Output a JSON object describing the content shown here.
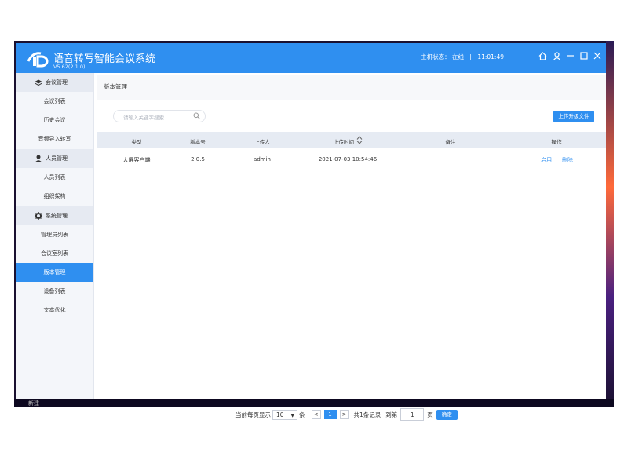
{
  "app": {
    "title": "语音转写智能会议系统",
    "version": "V5.62(2.1.0)",
    "host_label": "主机状态：",
    "host_status": "在线",
    "separator": "|",
    "time": "11:01:49"
  },
  "sidebar": {
    "groups": [
      {
        "label": "会议管理",
        "icon": "layers-icon",
        "items": [
          "会议列表",
          "历史会议",
          "音频导入转写"
        ]
      },
      {
        "label": "人员管理",
        "icon": "user-icon",
        "items": [
          "人员列表",
          "组织架构"
        ]
      },
      {
        "label": "系统管理",
        "icon": "gear-icon",
        "items": [
          "管理员列表",
          "会议室列表",
          "版本管理",
          "设备列表",
          "文本优化"
        ]
      }
    ],
    "active_item": "版本管理"
  },
  "main": {
    "breadcrumb": "版本管理",
    "search_placeholder": "请输入关键字搜索",
    "upload_label": "上传升级文件",
    "columns": [
      "类型",
      "版本号",
      "上传人",
      "上传时间",
      "备注",
      "操作"
    ],
    "rows": [
      {
        "type": "大屏客户端",
        "version": "2.0.5",
        "uploader": "admin",
        "time": "2021-07-03 10:54:46",
        "remark": "",
        "action_enable": "启用",
        "action_delete": "删除"
      }
    ]
  },
  "pagination": {
    "per_page_label": "当前每页显示",
    "per_page": "10",
    "unit": "条",
    "prev": "<",
    "page": "1",
    "next": ">",
    "total": "共1条记录",
    "goto_label": "到第",
    "goto_value": "1",
    "page_unit": "页",
    "confirm": "确定"
  },
  "taskbar": {
    "text": "新建"
  },
  "colors": {
    "primary": "#2f8ff0",
    "sidebar_bg": "#f4f6fa",
    "table_header": "#e6ebf3"
  }
}
